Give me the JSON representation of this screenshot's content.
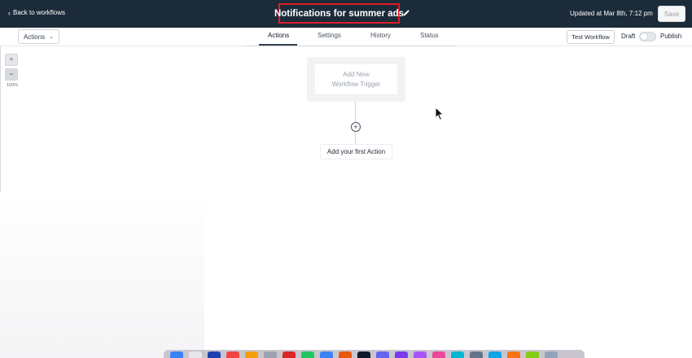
{
  "header": {
    "back_label": "Back to workflows",
    "workflow_title": "Notifications for summer ads",
    "updated": "Updated at Mar 8th, 7:12 pm",
    "save_label": "Save"
  },
  "toolbar": {
    "actions_dropdown": "Actions",
    "tabs": [
      {
        "label": "Actions",
        "active": true
      },
      {
        "label": "Settings",
        "active": false
      },
      {
        "label": "History",
        "active": false
      },
      {
        "label": "Status",
        "active": false
      }
    ],
    "test_workflow": "Test Workflow",
    "draft_label": "Draft",
    "publish_label": "Publish",
    "publish_toggle_on": false
  },
  "zoom": {
    "plus": "+",
    "minus": "−",
    "level": "100%"
  },
  "canvas": {
    "trigger_line1": "Add New",
    "trigger_line2": "Workflow Trigger",
    "add_first_action": "Add your first Action"
  },
  "colors": {
    "header_bg": "#1c2b39",
    "highlight": "#e11d2a"
  },
  "dock_icons": [
    "#3b82f6",
    "#e5e7eb",
    "#1e40af",
    "#ef4444",
    "#f59e0b",
    "#9ca3af",
    "#dc2626",
    "#22c55e",
    "#3b82f6",
    "#ea580c",
    "#111827",
    "#6366f1",
    "#7c3aed",
    "#a855f7",
    "#ec4899",
    "#06b6d4",
    "#64748b",
    "#0ea5e9",
    "#f97316",
    "#84cc16",
    "#94a3b8"
  ]
}
